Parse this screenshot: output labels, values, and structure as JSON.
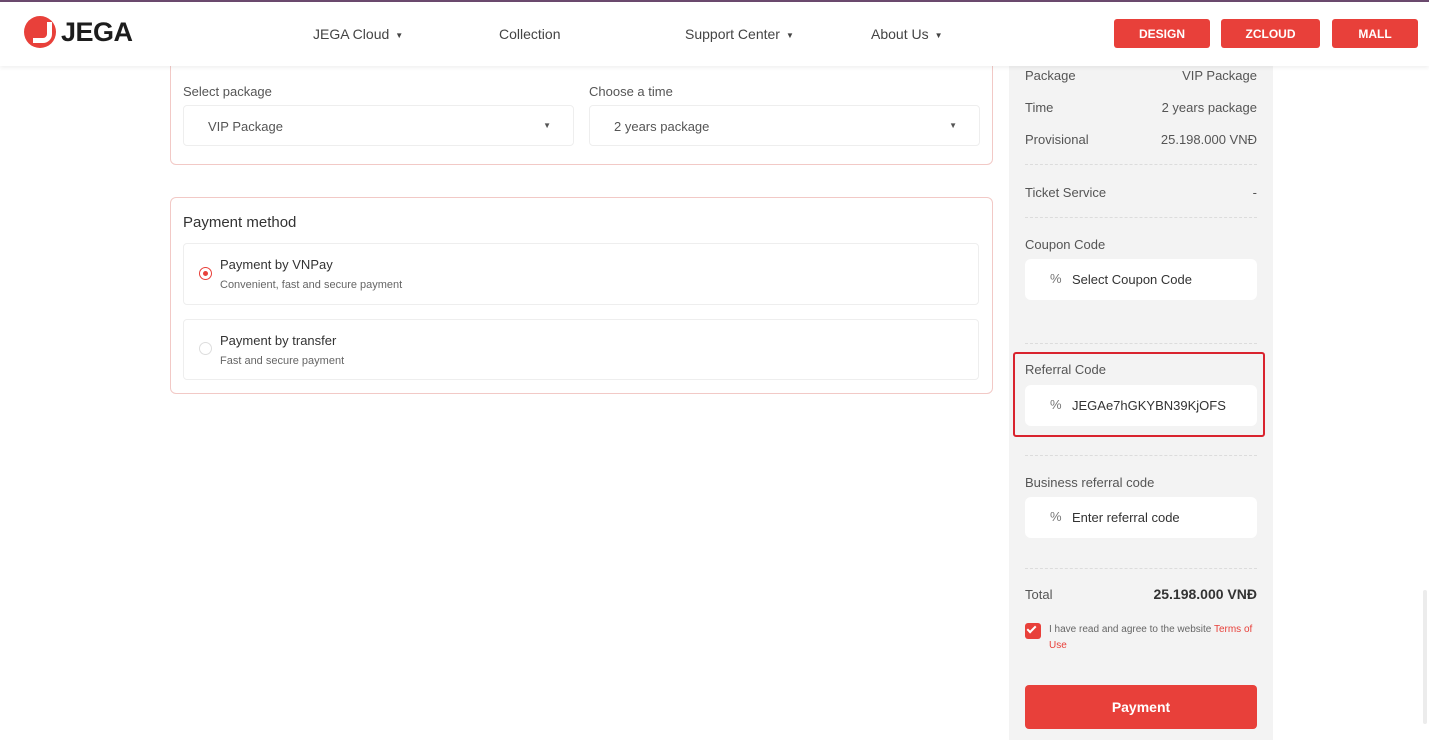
{
  "brand": {
    "name": "JEGA"
  },
  "nav": {
    "items": [
      {
        "label": "JEGA Cloud",
        "has_caret": true
      },
      {
        "label": "Collection",
        "has_caret": false
      },
      {
        "label": "Support Center",
        "has_caret": true
      },
      {
        "label": "About Us",
        "has_caret": true
      }
    ],
    "caret": "▼",
    "buttons": [
      "DESIGN",
      "ZCLOUD",
      "MALL"
    ]
  },
  "package_form": {
    "package_label": "Select package",
    "package_value": "VIP Package",
    "time_label": "Choose a time",
    "time_value": "2 years package",
    "caret": "▼"
  },
  "payment_method": {
    "title": "Payment method",
    "options": [
      {
        "name": "Payment by VNPay",
        "desc": "Convenient, fast and secure payment",
        "selected": true
      },
      {
        "name": "Payment by transfer",
        "desc": "Fast and secure payment",
        "selected": false
      }
    ]
  },
  "summary": {
    "rows": [
      {
        "label": "Package",
        "value": "VIP Package"
      },
      {
        "label": "Time",
        "value": "2 years package"
      },
      {
        "label": "Provisional",
        "value": "25.198.000 VNĐ"
      }
    ],
    "ticket_service": {
      "label": "Ticket Service",
      "value": "-"
    },
    "percent_glyph": "%",
    "coupon": {
      "label": "Coupon Code",
      "value": "Select Coupon Code"
    },
    "referral": {
      "label": "Referral Code",
      "value": "JEGAe7hGKYBN39KjOFS"
    },
    "business_referral": {
      "label": "Business referral code",
      "placeholder": "Enter referral code"
    },
    "total": {
      "label": "Total",
      "value": "25.198.000 VNĐ"
    },
    "agree_text": "I have read and agree to the website ",
    "terms_link": "Terms of Use",
    "agree_checked": true,
    "pay_button": "Payment"
  },
  "colors": {
    "accent": "#e8403a",
    "highlight_border": "#d9232e",
    "sidebar_bg": "#f3f3f3"
  }
}
